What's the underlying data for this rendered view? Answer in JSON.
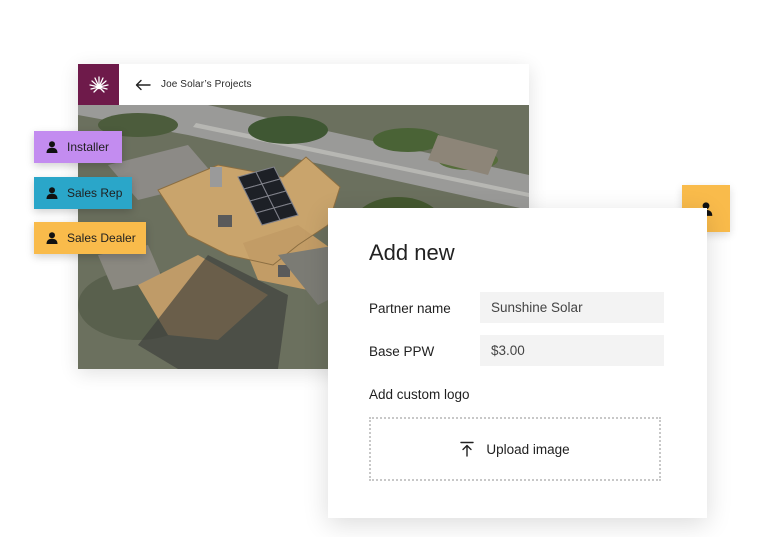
{
  "project_window": {
    "header": {
      "logo_icon": "sunburst-logo-icon",
      "back_icon": "arrow-left-icon",
      "title": "Joe Solar’s Projects"
    },
    "map_icon": "aerial-roof-map"
  },
  "role_tags": [
    {
      "label": "Installer",
      "icon": "user-icon",
      "color": "#c38cf0"
    },
    {
      "label": "Sales Rep",
      "icon": "user-icon",
      "color": "#2aa6c9"
    },
    {
      "label": "Sales Dealer",
      "icon": "user-icon",
      "color": "#f9bb4b"
    }
  ],
  "user_badge": {
    "icon": "user-icon",
    "color": "#f9bb4b"
  },
  "add_new": {
    "title": "Add new",
    "partner_name": {
      "label": "Partner name",
      "value": "Sunshine Solar"
    },
    "base_ppw": {
      "label": "Base PPW",
      "value": "$3.00"
    },
    "custom_logo": {
      "label": "Add custom logo",
      "upload_label": "Upload image",
      "upload_icon": "upload-icon"
    }
  },
  "colors": {
    "brand": "#6e1a4a",
    "accent": "#f9bb4b"
  }
}
